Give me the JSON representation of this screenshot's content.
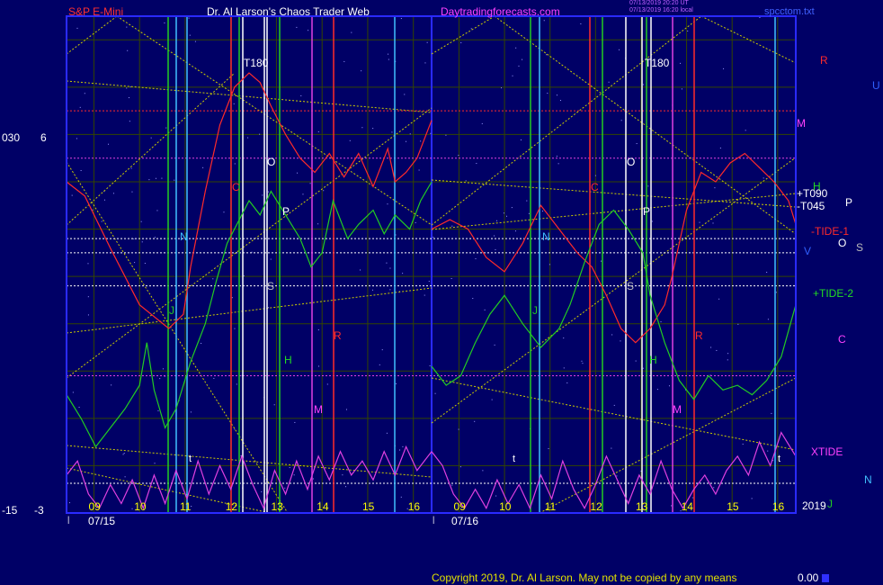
{
  "header": {
    "symbol": "S&P E-Mini",
    "site_title": "Dr. Al Larson's Chaos Trader Web",
    "site_url": "Daytradingforecasts.com",
    "stamp_line1": "07/13/2019 20:20 UT",
    "stamp_line2": "07/13/2019 16:20 local",
    "file_name": "spcctom.txt"
  },
  "footer": {
    "copyright": "Copyright 2019, Dr. Al Larson. May not be copied by any means",
    "readout": "0.00"
  },
  "colors": {
    "background": "#000066",
    "frame": "#2a2aff",
    "tide1": "#ff2a2a",
    "tide2": "#22cc22",
    "xtide": "#e040e0",
    "moon_lines": "#cccc00",
    "white_lines": "#ffffff"
  },
  "chart_data": {
    "type": "line",
    "title": "",
    "xlabel": "",
    "ylabel": "",
    "day_labels": [
      "07/15",
      "07/16"
    ],
    "hour_ticks": [
      "09",
      "10",
      "11",
      "12",
      "13",
      "14",
      "15",
      "16",
      "09",
      "10",
      "11",
      "12",
      "13",
      "14",
      "15",
      "16"
    ],
    "year_label": "2019",
    "left_axis_labels": [
      {
        "label": "030",
        "value": 6
      },
      {
        "label": "-15",
        "value": -3
      }
    ],
    "left_axis_values": [
      "6",
      "-3"
    ],
    "right_labels": {
      "R": "R",
      "U": "U",
      "M": "M",
      "H": "H",
      "T090": "+T090",
      "T045": "-T045",
      "P": "P",
      "TIDE1": "-TIDE-1",
      "O": "O",
      "S": "S",
      "V": "V",
      "TIDE2": "+TIDE-2",
      "C": "C",
      "XTIDE": "XTIDE",
      "N": "N",
      "J": "J"
    },
    "in_chart_labels": {
      "T180": "T180",
      "O": "O",
      "P": "P",
      "S": "S",
      "C": "C",
      "N": "N",
      "J": "J",
      "H": "H",
      "R": "R",
      "M": "M",
      "t": "t"
    },
    "series": [
      {
        "name": "-TIDE-1",
        "day1": [
          [
            0,
            4.0
          ],
          [
            0.05,
            3.7
          ],
          [
            0.12,
            2.6
          ],
          [
            0.2,
            1.4
          ],
          [
            0.28,
            0.9
          ],
          [
            0.32,
            1.2
          ],
          [
            0.34,
            2.2
          ],
          [
            0.38,
            3.8
          ],
          [
            0.42,
            5.2
          ],
          [
            0.46,
            6.0
          ],
          [
            0.5,
            6.3
          ],
          [
            0.53,
            6.1
          ],
          [
            0.56,
            5.6
          ],
          [
            0.6,
            5.0
          ],
          [
            0.64,
            4.5
          ],
          [
            0.68,
            4.2
          ],
          [
            0.72,
            4.6
          ],
          [
            0.76,
            4.1
          ],
          [
            0.8,
            4.6
          ],
          [
            0.84,
            3.9
          ],
          [
            0.88,
            4.7
          ],
          [
            0.9,
            4.0
          ],
          [
            0.93,
            4.2
          ],
          [
            0.96,
            4.5
          ],
          [
            1.0,
            5.3
          ]
        ],
        "day2": [
          [
            0,
            3.0
          ],
          [
            0.05,
            3.2
          ],
          [
            0.1,
            3.0
          ],
          [
            0.15,
            2.4
          ],
          [
            0.2,
            2.1
          ],
          [
            0.25,
            2.7
          ],
          [
            0.3,
            3.5
          ],
          [
            0.35,
            3.0
          ],
          [
            0.4,
            2.5
          ],
          [
            0.44,
            2.2
          ],
          [
            0.48,
            1.6
          ],
          [
            0.52,
            0.9
          ],
          [
            0.56,
            0.6
          ],
          [
            0.6,
            0.9
          ],
          [
            0.64,
            1.4
          ],
          [
            0.66,
            2.0
          ],
          [
            0.7,
            3.4
          ],
          [
            0.74,
            4.2
          ],
          [
            0.78,
            4.0
          ],
          [
            0.82,
            4.4
          ],
          [
            0.86,
            4.6
          ],
          [
            0.9,
            4.3
          ],
          [
            0.94,
            4.0
          ],
          [
            0.98,
            3.6
          ],
          [
            1.0,
            3.1
          ]
        ]
      },
      {
        "name": "+TIDE-2",
        "day1": [
          [
            0,
            -0.5
          ],
          [
            0.04,
            -1.0
          ],
          [
            0.08,
            -1.6
          ],
          [
            0.12,
            -1.2
          ],
          [
            0.16,
            -0.8
          ],
          [
            0.2,
            -0.3
          ],
          [
            0.22,
            0.6
          ],
          [
            0.24,
            -0.4
          ],
          [
            0.27,
            -1.2
          ],
          [
            0.3,
            -0.8
          ],
          [
            0.34,
            0.2
          ],
          [
            0.38,
            1.0
          ],
          [
            0.41,
            1.9
          ],
          [
            0.44,
            2.7
          ],
          [
            0.5,
            3.6
          ],
          [
            0.53,
            3.3
          ],
          [
            0.56,
            3.8
          ],
          [
            0.6,
            3.3
          ],
          [
            0.64,
            2.8
          ],
          [
            0.67,
            2.2
          ],
          [
            0.7,
            2.5
          ],
          [
            0.73,
            3.6
          ],
          [
            0.77,
            2.8
          ],
          [
            0.8,
            3.1
          ],
          [
            0.84,
            3.4
          ],
          [
            0.87,
            2.9
          ],
          [
            0.9,
            3.3
          ],
          [
            0.94,
            3.0
          ],
          [
            0.97,
            3.6
          ],
          [
            1.0,
            4.0
          ]
        ],
        "day2": [
          [
            0,
            0.1
          ],
          [
            0.04,
            -0.3
          ],
          [
            0.08,
            -0.1
          ],
          [
            0.12,
            0.6
          ],
          [
            0.16,
            1.2
          ],
          [
            0.2,
            1.6
          ],
          [
            0.25,
            1.0
          ],
          [
            0.3,
            0.5
          ],
          [
            0.35,
            0.9
          ],
          [
            0.38,
            1.4
          ],
          [
            0.42,
            2.3
          ],
          [
            0.46,
            3.1
          ],
          [
            0.5,
            3.4
          ],
          [
            0.54,
            3.0
          ],
          [
            0.58,
            2.5
          ],
          [
            0.6,
            1.6
          ],
          [
            0.64,
            0.6
          ],
          [
            0.68,
            -0.2
          ],
          [
            0.72,
            -0.6
          ],
          [
            0.76,
            -0.1
          ],
          [
            0.8,
            -0.4
          ],
          [
            0.84,
            -0.3
          ],
          [
            0.88,
            -0.5
          ],
          [
            0.92,
            -0.2
          ],
          [
            0.96,
            0.3
          ],
          [
            1.0,
            1.4
          ]
        ]
      },
      {
        "name": "XTIDE",
        "day1": [
          [
            0,
            -2.2
          ],
          [
            0.03,
            -1.9
          ],
          [
            0.06,
            -2.6
          ],
          [
            0.09,
            -2.9
          ],
          [
            0.12,
            -2.4
          ],
          [
            0.15,
            -2.8
          ],
          [
            0.18,
            -2.3
          ],
          [
            0.21,
            -2.9
          ],
          [
            0.24,
            -2.2
          ],
          [
            0.27,
            -2.8
          ],
          [
            0.3,
            -2.1
          ],
          [
            0.33,
            -2.7
          ],
          [
            0.36,
            -1.9
          ],
          [
            0.39,
            -2.6
          ],
          [
            0.42,
            -2.0
          ],
          [
            0.45,
            -2.5
          ],
          [
            0.48,
            -1.8
          ],
          [
            0.51,
            -2.4
          ],
          [
            0.54,
            -2.9
          ],
          [
            0.57,
            -2.1
          ],
          [
            0.6,
            -2.6
          ],
          [
            0.63,
            -1.9
          ],
          [
            0.66,
            -2.5
          ],
          [
            0.69,
            -1.8
          ],
          [
            0.72,
            -2.3
          ],
          [
            0.75,
            -1.7
          ],
          [
            0.78,
            -2.2
          ],
          [
            0.81,
            -1.9
          ],
          [
            0.84,
            -2.3
          ],
          [
            0.87,
            -1.7
          ],
          [
            0.9,
            -2.2
          ],
          [
            0.93,
            -1.6
          ],
          [
            0.96,
            -2.1
          ],
          [
            1.0,
            -1.7
          ]
        ],
        "day2": [
          [
            0,
            -1.7
          ],
          [
            0.03,
            -2.0
          ],
          [
            0.06,
            -2.6
          ],
          [
            0.09,
            -2.9
          ],
          [
            0.12,
            -2.5
          ],
          [
            0.15,
            -2.9
          ],
          [
            0.18,
            -2.3
          ],
          [
            0.21,
            -2.8
          ],
          [
            0.24,
            -2.4
          ],
          [
            0.27,
            -2.9
          ],
          [
            0.3,
            -2.2
          ],
          [
            0.33,
            -2.7
          ],
          [
            0.36,
            -1.9
          ],
          [
            0.39,
            -2.5
          ],
          [
            0.42,
            -2.9
          ],
          [
            0.45,
            -2.4
          ],
          [
            0.48,
            -1.8
          ],
          [
            0.51,
            -2.3
          ],
          [
            0.54,
            -2.8
          ],
          [
            0.57,
            -2.2
          ],
          [
            0.6,
            -2.6
          ],
          [
            0.63,
            -1.9
          ],
          [
            0.66,
            -2.5
          ],
          [
            0.69,
            -2.9
          ],
          [
            0.72,
            -2.5
          ],
          [
            0.75,
            -2.2
          ],
          [
            0.78,
            -2.6
          ],
          [
            0.81,
            -2.1
          ],
          [
            0.84,
            -1.8
          ],
          [
            0.87,
            -2.2
          ],
          [
            0.9,
            -1.5
          ],
          [
            0.93,
            -2.0
          ],
          [
            0.96,
            -1.3
          ],
          [
            1.0,
            -1.8
          ]
        ]
      }
    ],
    "horizontal_levels": [
      {
        "name": "R",
        "value": 5.5
      },
      {
        "name": "M",
        "value": 4.5
      },
      {
        "name": "+T090",
        "value": 2.8
      },
      {
        "name": "-T045",
        "value": 2.5
      },
      {
        "name": "O",
        "value": 1.8
      },
      {
        "name": "C",
        "value": -0.1
      }
    ],
    "ylim": [
      -3.0,
      7.5
    ]
  }
}
